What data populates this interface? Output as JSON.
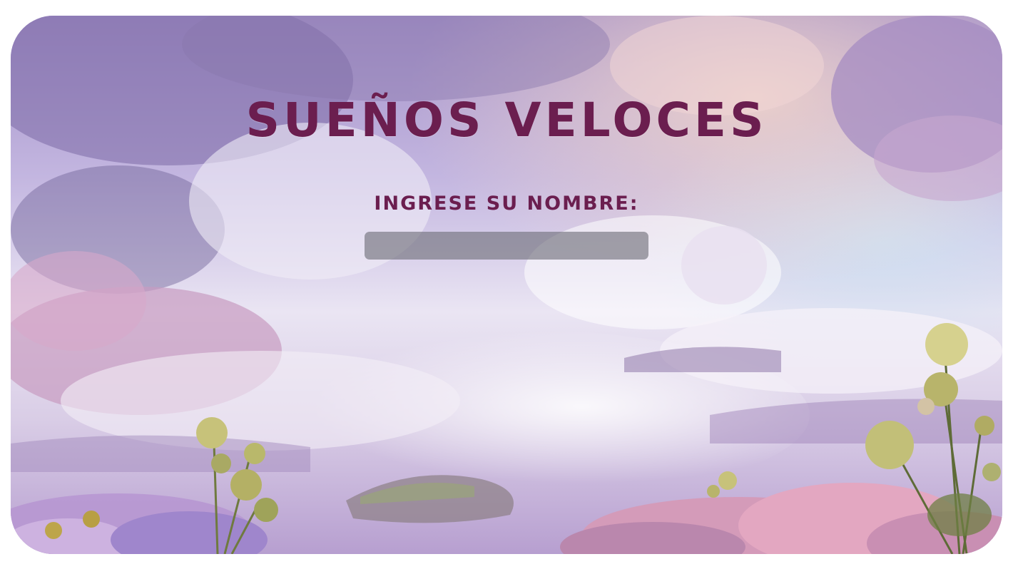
{
  "game": {
    "title": "SUEÑOS VELOCES",
    "name_prompt": "INGRESE SU NOMBRE:",
    "name_input": {
      "value": "",
      "placeholder": ""
    }
  },
  "colors": {
    "title_text": "#6b1e4f",
    "input_background": "#6e6e78",
    "page_background": "#ffffff"
  },
  "icons": {
    "background": "dreamy-cloud-landscape-image"
  }
}
